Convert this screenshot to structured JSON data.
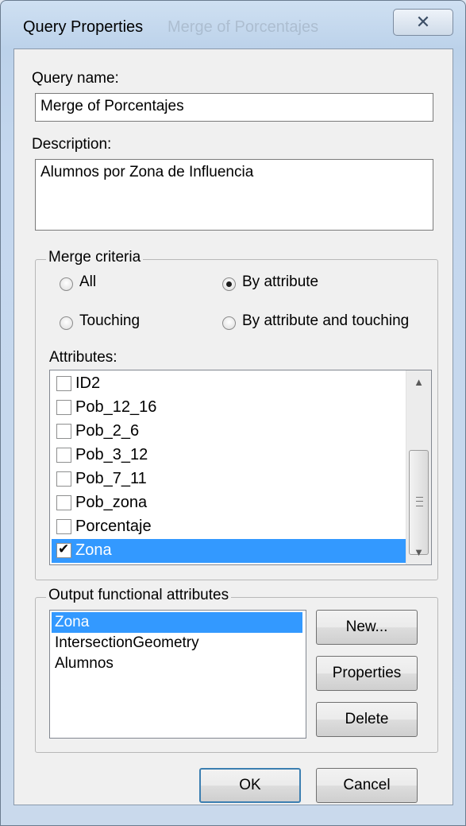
{
  "window": {
    "title": "Query Properties",
    "title_ghost": "Merge of Porcentajes",
    "close_glyph": "✕"
  },
  "query": {
    "name_label": "Query name:",
    "name_value": "Merge of Porcentajes",
    "description_label": "Description:",
    "description_value": "Alumnos por Zona de Influencia"
  },
  "merge_criteria": {
    "title": "Merge criteria",
    "options": [
      {
        "label": "All",
        "checked": false
      },
      {
        "label": "By attribute",
        "checked": true
      },
      {
        "label": "Touching",
        "checked": false
      },
      {
        "label": "By attribute and touching",
        "checked": false
      }
    ],
    "attributes_label": "Attributes:",
    "attributes": [
      {
        "label": "ID2",
        "checked": false,
        "selected": false
      },
      {
        "label": "Pob_12_16",
        "checked": false,
        "selected": false
      },
      {
        "label": "Pob_2_6",
        "checked": false,
        "selected": false
      },
      {
        "label": "Pob_3_12",
        "checked": false,
        "selected": false
      },
      {
        "label": "Pob_7_11",
        "checked": false,
        "selected": false
      },
      {
        "label": "Pob_zona",
        "checked": false,
        "selected": false
      },
      {
        "label": "Porcentaje",
        "checked": false,
        "selected": false
      },
      {
        "label": "Zona",
        "checked": true,
        "selected": true
      }
    ]
  },
  "output": {
    "title": "Output functional attributes",
    "items": [
      {
        "label": "Zona",
        "selected": true
      },
      {
        "label": "IntersectionGeometry",
        "selected": false
      },
      {
        "label": "Alumnos",
        "selected": false
      }
    ],
    "new_label": "New...",
    "properties_label": "Properties",
    "delete_label": "Delete"
  },
  "footer": {
    "ok_label": "OK",
    "cancel_label": "Cancel"
  },
  "colors": {
    "selection": "#3399ff",
    "dialog_bg": "#f0f0f0"
  }
}
